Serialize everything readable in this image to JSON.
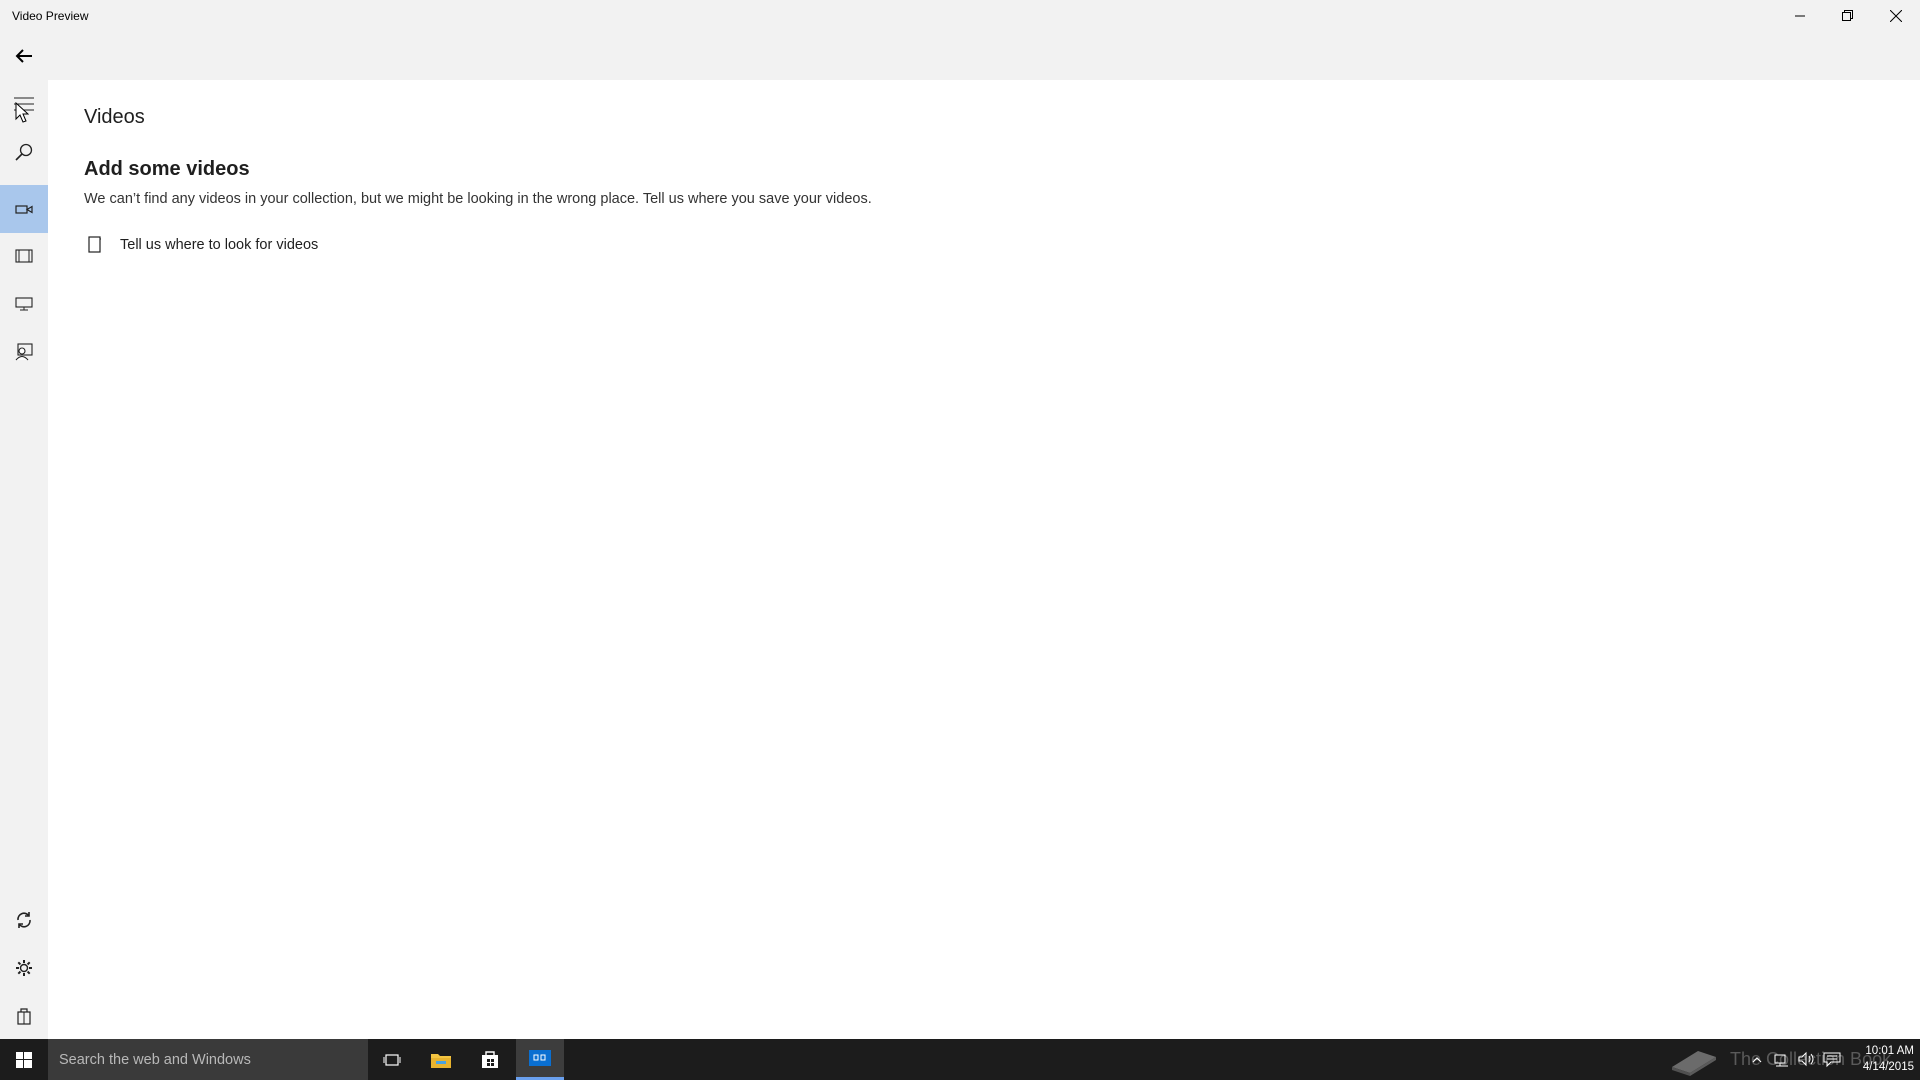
{
  "window": {
    "title": "Video Preview"
  },
  "nav": {
    "items": [
      {
        "name": "menu",
        "icon": "hamburger-icon"
      },
      {
        "name": "search",
        "icon": "search-icon"
      },
      {
        "name": "videos",
        "icon": "video-camera-icon",
        "selected": true
      },
      {
        "name": "movies",
        "icon": "film-icon"
      },
      {
        "name": "tv",
        "icon": "tv-icon"
      },
      {
        "name": "people",
        "icon": "person-icon"
      }
    ],
    "bottom": [
      {
        "name": "sync",
        "icon": "sync-icon"
      },
      {
        "name": "settings",
        "icon": "gear-icon"
      },
      {
        "name": "store",
        "icon": "store-bag-icon"
      }
    ]
  },
  "main": {
    "page_title": "Videos",
    "section_title": "Add some videos",
    "section_desc": "We can’t find any videos in your collection, but we might be looking in the wrong place. Tell us where you save your videos.",
    "locate_label": "Tell us where to look for videos"
  },
  "taskbar": {
    "search_placeholder": "Search the web and Windows",
    "watermark_text": "The Collection Book",
    "time": "10:01 AM",
    "date": "4/14/2015"
  },
  "colors": {
    "selected_nav": "#a9c7ec",
    "taskbar_bg": "#1c1c1c",
    "chrome_bg": "#f2f2f2",
    "accent": "#0078d7"
  }
}
